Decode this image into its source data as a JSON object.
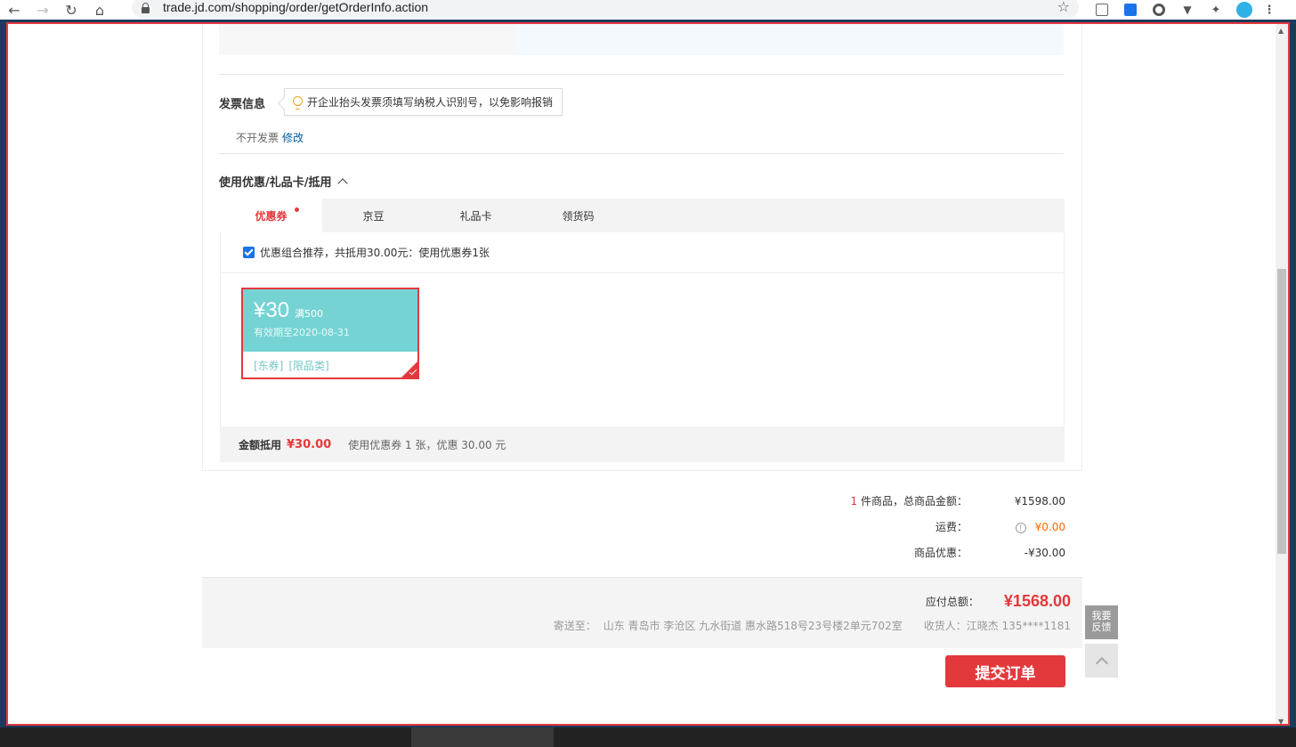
{
  "browser": {
    "url": "trade.jd.com/shopping/order/getOrderInfo.action"
  },
  "invoice": {
    "title": "发票信息",
    "tip": "开企业抬头发票须填写纳税人识别号，以免影响报销",
    "value": "不开发票",
    "edit": "修改"
  },
  "coupon_section": {
    "title": "使用优惠/礼品卡/抵用",
    "tabs": [
      {
        "label": "优惠券"
      },
      {
        "label": "京豆"
      },
      {
        "label": "礼品卡"
      },
      {
        "label": "领货码"
      }
    ],
    "combo_text": "优惠组合推荐，共抵用30.00元：使用优惠券1张",
    "coupon": {
      "amount": "¥30",
      "condition": "满500",
      "expire": "有效期至2020-08-31",
      "tag1": "[东券]",
      "tag2": "[限品类]",
      "accent": "#75d3d4"
    },
    "summary_label": "金额抵用",
    "summary_amount": "¥30.00",
    "summary_desc": "使用优惠券 1 张，优惠 30.00 元"
  },
  "totals": {
    "count": "1",
    "count_label": " 件商品，总商品金额：",
    "goods_amount": "¥1598.00",
    "shipping_label": "运费：",
    "shipping_amount": "¥0.00",
    "discount_label": "商品优惠：",
    "discount_amount": "-¥30.00"
  },
  "payment": {
    "label": "应付总额：",
    "amount": "¥1568.00",
    "address_label": "寄送至：",
    "address": "山东 青岛市 李沧区 九水街道 惠水路518号23号楼2单元702室",
    "receiver_label": "收货人：",
    "receiver": "江晓杰 135****1181"
  },
  "submit_label": "提交订单",
  "sidebar": {
    "feedback_line1": "我要",
    "feedback_line2": "反馈"
  },
  "colors": {
    "brand_red": "#e4393c",
    "link_blue": "#005aa0",
    "shipping_orange": "#ff6600"
  }
}
